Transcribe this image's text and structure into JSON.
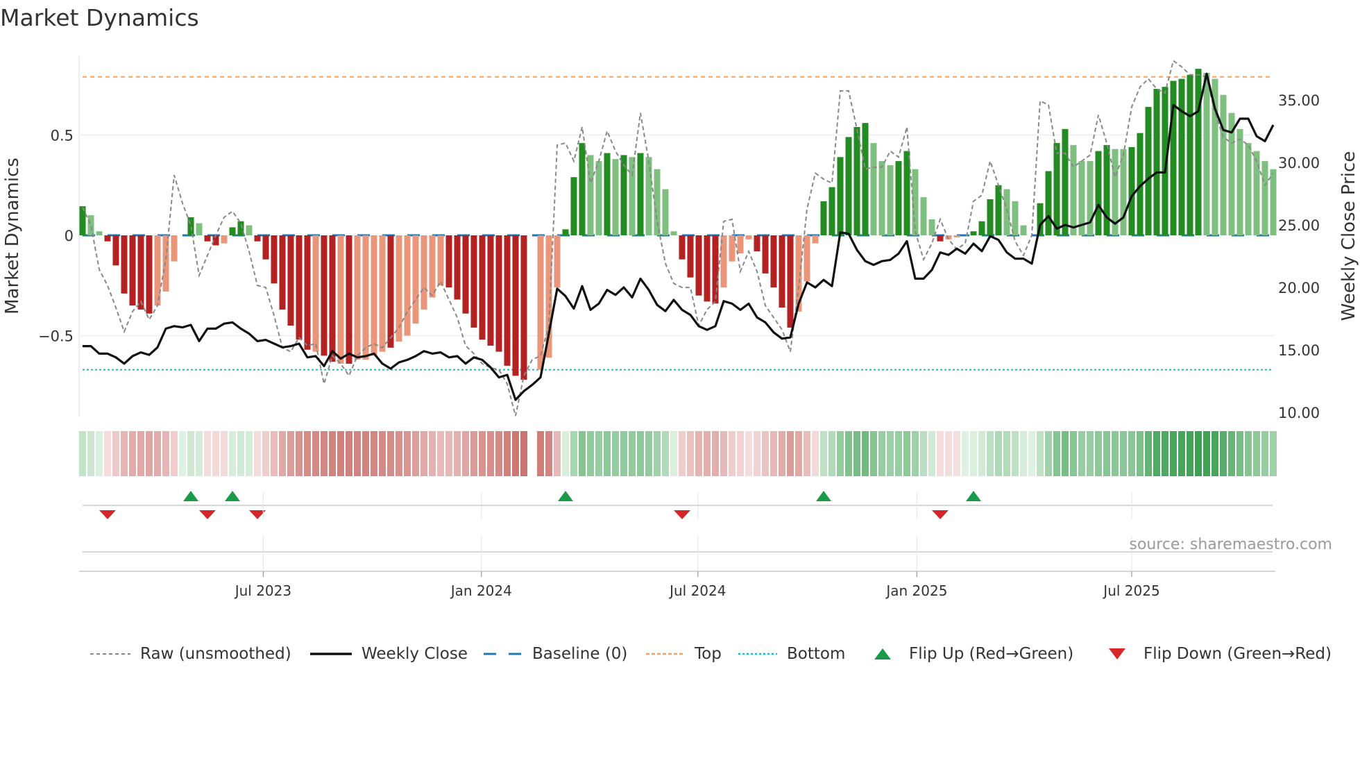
{
  "title": "Market Dynamics",
  "source": "source: sharemaestro.com",
  "legend": [
    {
      "key": "raw",
      "label": "Raw (unsmoothed)"
    },
    {
      "key": "close",
      "label": "Weekly Close"
    },
    {
      "key": "baseline",
      "label": "Baseline (0)"
    },
    {
      "key": "top",
      "label": "Top"
    },
    {
      "key": "bottom",
      "label": "Bottom"
    },
    {
      "key": "flip_up",
      "label": "Flip Up (Red→Green)"
    },
    {
      "key": "flip_down",
      "label": "Flip Down (Green→Red)"
    }
  ],
  "colors": {
    "strong_up": "#228b22",
    "weak_up": "#7fbf7f",
    "strong_down": "#b22222",
    "weak_down": "#e9967a",
    "close": "#111111",
    "raw": "#888888",
    "baseline": "#1f77b4",
    "top": "#f4a460",
    "bottom": "#17becf",
    "flip_up": "#1a9a48",
    "flip_down": "#d62728"
  },
  "chart_data": {
    "type": "bar",
    "title": "Market Dynamics",
    "ylabel": "Market Dynamics",
    "y2label": "Weekly Close Price",
    "ylim": [
      -0.9,
      0.9
    ],
    "y2lim": [
      10,
      37.5
    ],
    "y_ticks": [
      {
        "value": 0.5,
        "label": "0.5"
      },
      {
        "value": 0,
        "label": "0"
      },
      {
        "value": -0.5,
        "label": "−0.5"
      }
    ],
    "y2_ticks": [
      {
        "value": 35,
        "label": "35.00"
      },
      {
        "value": 30,
        "label": "30.00"
      },
      {
        "value": 25,
        "label": "25.00"
      },
      {
        "value": 20,
        "label": "20.00"
      },
      {
        "value": 15,
        "label": "15.00"
      },
      {
        "value": 10,
        "label": "10.00"
      }
    ],
    "x_ticks": [
      {
        "week": 21.7,
        "label": "Jul 2023"
      },
      {
        "week": 47.9,
        "label": "Jan 2024"
      },
      {
        "week": 73.9,
        "label": "Jul 2024"
      },
      {
        "week": 100.2,
        "label": "Jan 2025"
      },
      {
        "week": 126,
        "label": "Jul 2025"
      }
    ],
    "top_level": 0.79,
    "bottom_level": -0.67,
    "baseline": 0,
    "dynamics": [
      0.145,
      0.1,
      0.02,
      -0.03,
      -0.15,
      -0.29,
      -0.35,
      -0.37,
      -0.39,
      -0.35,
      -0.28,
      -0.13,
      0,
      0.09,
      0.06,
      -0.03,
      -0.05,
      -0.04,
      0.04,
      0.07,
      0.05,
      -0.03,
      -0.12,
      -0.24,
      -0.37,
      -0.45,
      -0.52,
      -0.57,
      -0.58,
      -0.6,
      -0.63,
      -0.64,
      -0.64,
      -0.62,
      -0.62,
      -0.6,
      -0.58,
      -0.56,
      -0.53,
      -0.5,
      -0.44,
      -0.37,
      -0.31,
      -0.25,
      -0.26,
      -0.32,
      -0.39,
      -0.46,
      -0.52,
      -0.55,
      -0.58,
      -0.65,
      -0.7,
      -0.72,
      null,
      -0.67,
      -0.61,
      -0.26,
      0.03,
      0.29,
      0.46,
      0.4,
      0.37,
      0.41,
      0.38,
      0.4,
      0.39,
      0.41,
      0.39,
      0.33,
      0.23,
      0.02,
      -0.12,
      -0.21,
      -0.3,
      -0.33,
      -0.34,
      -0.26,
      -0.13,
      -0.09,
      -0.02,
      -0.08,
      -0.19,
      -0.26,
      -0.36,
      -0.46,
      -0.38,
      -0.23,
      -0.04,
      0.17,
      0.24,
      0.39,
      0.49,
      0.54,
      0.56,
      0.46,
      0.37,
      0.35,
      0.37,
      0.42,
      0.33,
      0.19,
      0.08,
      -0.03,
      -0.02,
      -0.01,
      0,
      0.02,
      0.07,
      0.18,
      0.25,
      0.23,
      0.17,
      0.05,
      0,
      0.16,
      0.32,
      0.46,
      0.53,
      0.45,
      0.37,
      0.37,
      0.42,
      0.45,
      0.43,
      0.43,
      0.44,
      0.51,
      0.64,
      0.73,
      0.74,
      0.77,
      0.78,
      0.8,
      0.83,
      0.81,
      0.78,
      0.7,
      0.61,
      0.53,
      0.46,
      0.42,
      0.37,
      0.33
    ],
    "bar_state": "GggRRRRRRrrr0GgRRrGGgRRRRRRRrRRrRrrrrRrrrrrrRRRRRRRRRR-rrrGGGggGgGgGggggRRRRRrrrrRRRRRrrrGGGGGGgggGGgggRrr0GGGGggg0GGGGgggGGggGGGGGGGGGggggggggg",
    "raw": [
      0.14,
      0.05,
      -0.17,
      -0.25,
      -0.36,
      -0.48,
      -0.38,
      -0.33,
      -0.42,
      -0.35,
      -0.12,
      0.3,
      0.16,
      0.05,
      -0.2,
      -0.1,
      0.0,
      0.09,
      0.12,
      0.06,
      -0.08,
      -0.25,
      -0.26,
      -0.4,
      -0.56,
      -0.58,
      -0.51,
      -0.55,
      -0.54,
      -0.74,
      -0.6,
      -0.64,
      -0.7,
      -0.6,
      -0.56,
      -0.54,
      -0.56,
      -0.51,
      -0.46,
      -0.38,
      -0.32,
      -0.26,
      -0.3,
      -0.23,
      -0.32,
      -0.41,
      -0.55,
      -0.59,
      -0.64,
      -0.66,
      -0.67,
      -0.74,
      -0.9,
      -0.7,
      -0.62,
      -0.6,
      -0.45,
      0.45,
      0.46,
      0.37,
      0.54,
      0.26,
      0.37,
      0.52,
      0.42,
      0.35,
      0.3,
      0.61,
      0.37,
      0.07,
      -0.14,
      -0.24,
      -0.26,
      -0.26,
      -0.45,
      -0.37,
      -0.33,
      0.07,
      0.08,
      -0.18,
      -0.08,
      -0.18,
      -0.35,
      -0.41,
      -0.47,
      -0.58,
      -0.26,
      0.13,
      0.31,
      0.28,
      0.26,
      0.72,
      0.72,
      0.53,
      0.33,
      0.34,
      0.34,
      0.42,
      0.39,
      0.54,
      0.02,
      -0.12,
      -0.04,
      0.08,
      -0.02,
      -0.07,
      -0.04,
      0.17,
      0.2,
      0.37,
      0.25,
      0.13,
      -0.03,
      -0.1,
      0.0,
      0.67,
      0.65,
      0.41,
      0.41,
      0.34,
      0.37,
      0.4,
      0.6,
      0.46,
      0.29,
      0.4,
      0.64,
      0.74,
      0.78,
      0.73,
      0.71,
      0.87,
      0.84,
      0.8,
      0.8,
      0.79,
      0.61,
      0.49,
      0.46,
      0.48,
      0.45,
      0.37,
      0.25,
      0.31
    ],
    "weekly_close": [
      15.3,
      15.3,
      14.7,
      14.7,
      14.4,
      13.9,
      14.5,
      14.8,
      14.6,
      15.2,
      16.7,
      16.9,
      16.8,
      17.0,
      15.7,
      16.7,
      16.7,
      17.1,
      17.2,
      16.7,
      16.3,
      15.7,
      15.8,
      15.5,
      15.2,
      15.3,
      15.5,
      14.4,
      14.5,
      13.7,
      14.9,
      14.3,
      14.7,
      14.4,
      14.5,
      14.7,
      13.9,
      13.5,
      14.0,
      14.2,
      14.5,
      14.9,
      14.7,
      14.8,
      14.4,
      14.5,
      13.9,
      14.4,
      14.2,
      13.6,
      12.8,
      13.0,
      11.0,
      11.7,
      12.2,
      12.8,
      16.3,
      19.9,
      19.3,
      18.3,
      20.1,
      18.2,
      18.7,
      19.8,
      19.4,
      20.0,
      19.2,
      20.7,
      19.8,
      18.6,
      18.1,
      19.0,
      18.2,
      17.8,
      16.9,
      16.6,
      16.9,
      18.9,
      18.7,
      18.2,
      18.7,
      17.6,
      17.2,
      16.4,
      15.9,
      16.0,
      18.7,
      20.4,
      20.0,
      20.6,
      20.1,
      24.4,
      24.3,
      23.0,
      22.1,
      21.8,
      22.1,
      22.2,
      22.7,
      23.7,
      20.7,
      20.7,
      21.4,
      22.8,
      22.6,
      23.1,
      22.7,
      23.5,
      22.9,
      24.1,
      23.8,
      22.8,
      22.3,
      22.3,
      21.9,
      25.0,
      25.7,
      24.7,
      25.0,
      24.8,
      25.0,
      25.2,
      26.6,
      25.6,
      25.1,
      25.6,
      27.3,
      28.1,
      28.7,
      29.2,
      29.2,
      34.6,
      34.1,
      33.7,
      34.1,
      37.1,
      34.3,
      32.6,
      32.4,
      33.5,
      33.5,
      32.1,
      31.7,
      33.0
    ],
    "flip_up_weeks": [
      13,
      18,
      58,
      89,
      107
    ],
    "flip_down_weeks": [
      3,
      15,
      21,
      72,
      103
    ]
  }
}
